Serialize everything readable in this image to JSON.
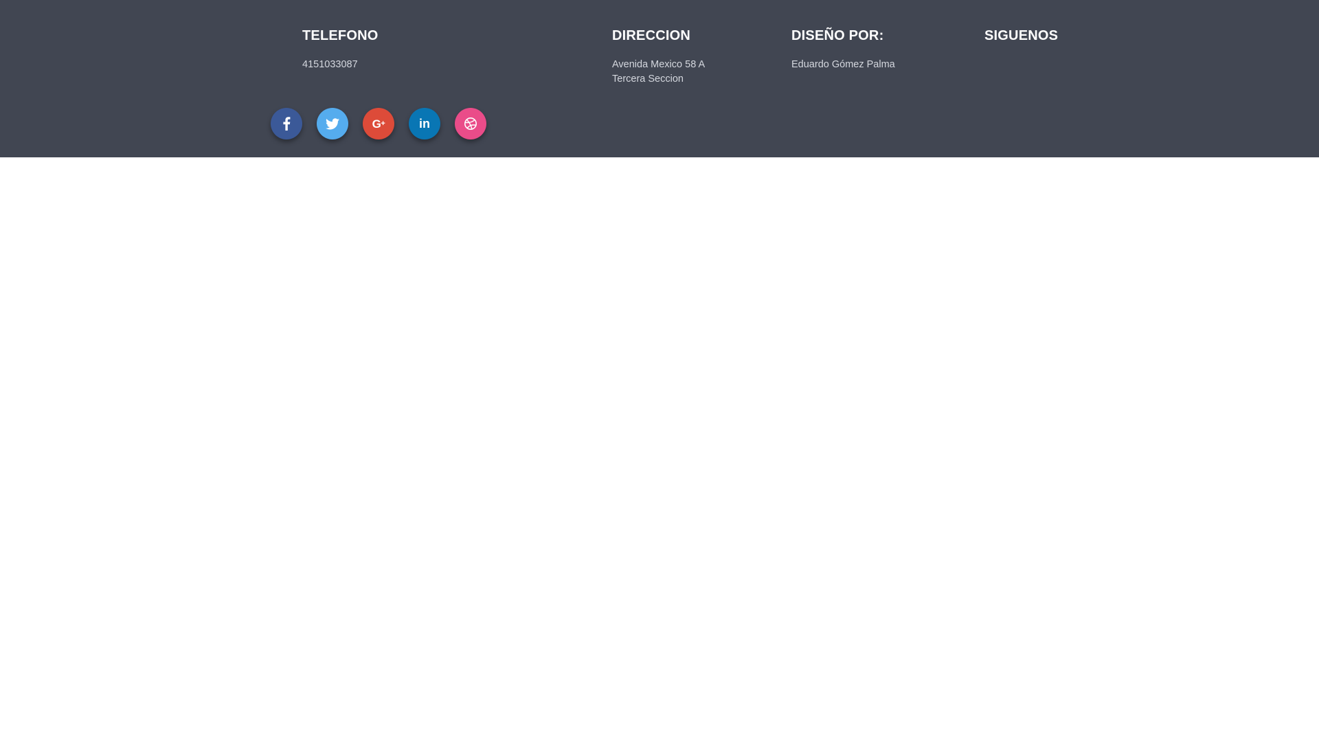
{
  "footer": {
    "phone": {
      "heading": "TELEFONO",
      "value": "4151033087"
    },
    "address": {
      "heading": "DIRECCION",
      "line1": "Avenida Mexico 58 A",
      "line2": "Tercera Seccion"
    },
    "design": {
      "heading": "DISEÑO POR:",
      "value": "Eduardo Gómez Palma"
    },
    "follow": {
      "heading": "SIGUENOS"
    },
    "socials": [
      {
        "network": "facebook",
        "icon": "facebook-icon",
        "color": "#3b5998"
      },
      {
        "network": "twitter",
        "icon": "twitter-icon",
        "color": "#55acee"
      },
      {
        "network": "google-plus",
        "icon": "google-plus-icon",
        "color": "#dd4b39"
      },
      {
        "network": "linkedin",
        "icon": "linkedin-icon",
        "color": "#0976b4"
      },
      {
        "network": "dribbble",
        "icon": "dribbble-icon",
        "color": "#ea4c89"
      }
    ],
    "background_color": "#414652"
  },
  "page": {
    "background_color": "#ffffff"
  }
}
